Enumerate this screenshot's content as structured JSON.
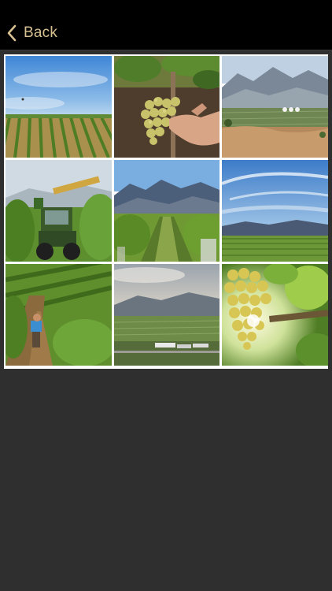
{
  "nav": {
    "back_label": "Back",
    "back_icon": "chevron-left-icon",
    "accent_color": "#d8c191",
    "background_color": "#000000"
  },
  "gallery": {
    "columns": 3,
    "rows": 3,
    "photos": [
      {
        "subject": "vineyard-rows-under-blue-sky"
      },
      {
        "subject": "hand-holding-white-grape-cluster"
      },
      {
        "subject": "valley-with-mountains-and-farm"
      },
      {
        "subject": "tractor-harvester-in-vineyard"
      },
      {
        "subject": "vineyard-row-toward-mountains"
      },
      {
        "subject": "vineyard-under-wispy-clouds"
      },
      {
        "subject": "worker-tending-vines"
      },
      {
        "subject": "misty-valley-with-buildings"
      },
      {
        "subject": "backlit-grape-cluster"
      }
    ]
  },
  "background_color": "#2f2f2f"
}
